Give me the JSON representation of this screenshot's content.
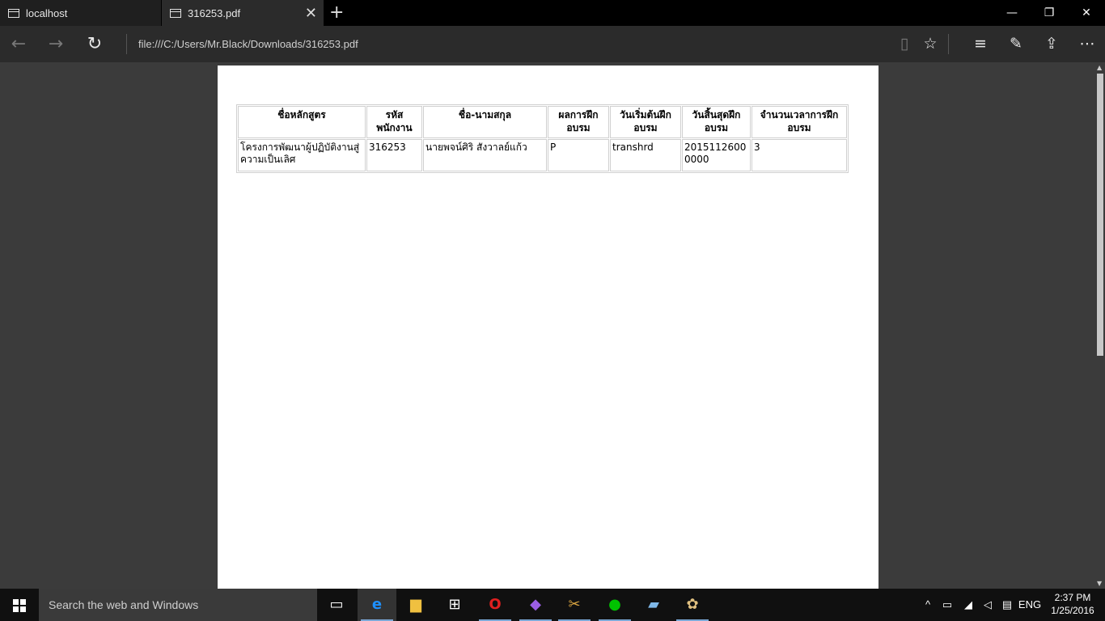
{
  "tabs": [
    {
      "title": "localhost"
    },
    {
      "title": "316253.pdf"
    }
  ],
  "address": {
    "url": "file:///C:/Users/Mr.Black/Downloads/316253.pdf"
  },
  "icons": {
    "back": "←",
    "forward": "→",
    "refresh": "↻",
    "reading_view": "▯",
    "favorite": "☆",
    "hub": "≡",
    "note": "✎",
    "share": "⇪",
    "more": "⋯",
    "close": "✕",
    "new_tab": "+",
    "minimize": "—",
    "restore": "❐",
    "win_close": "✕"
  },
  "document": {
    "headers": [
      "ชื่อหลักสูตร",
      "รหัส\nพนักงาน",
      "ชื่อ-นามสกุล",
      "ผลการฝึก\nอบรม",
      "วันเริ่มต้นฝึก\nอบรม",
      "วันสิ้นสุดฝึก\nอบรม",
      "จำนวนเวลาการฝึก\nอบรม"
    ],
    "rows": [
      [
        "โครงการพัฒนาผู้ปฏิบัติงานสู่ความเป็นเลิศ",
        "316253",
        "นายพจน์ศิริ สังวาลย์แก้ว",
        "P",
        "transhrd",
        "20151126000000",
        "3"
      ]
    ]
  },
  "taskbar": {
    "search_placeholder": "Search the web and Windows",
    "language": "ENG",
    "time": "2:37 PM",
    "date": "1/25/2016",
    "apps": [
      "task-view",
      "edge",
      "file-explorer",
      "store",
      "opera",
      "visual-studio",
      "tools",
      "line",
      "notepad",
      "paint"
    ]
  },
  "colors": {
    "accent": "#7aa7d6",
    "tabbar": "#000000",
    "toolbar": "#2b2b2b",
    "viewer_bg": "#3b3b3b"
  }
}
